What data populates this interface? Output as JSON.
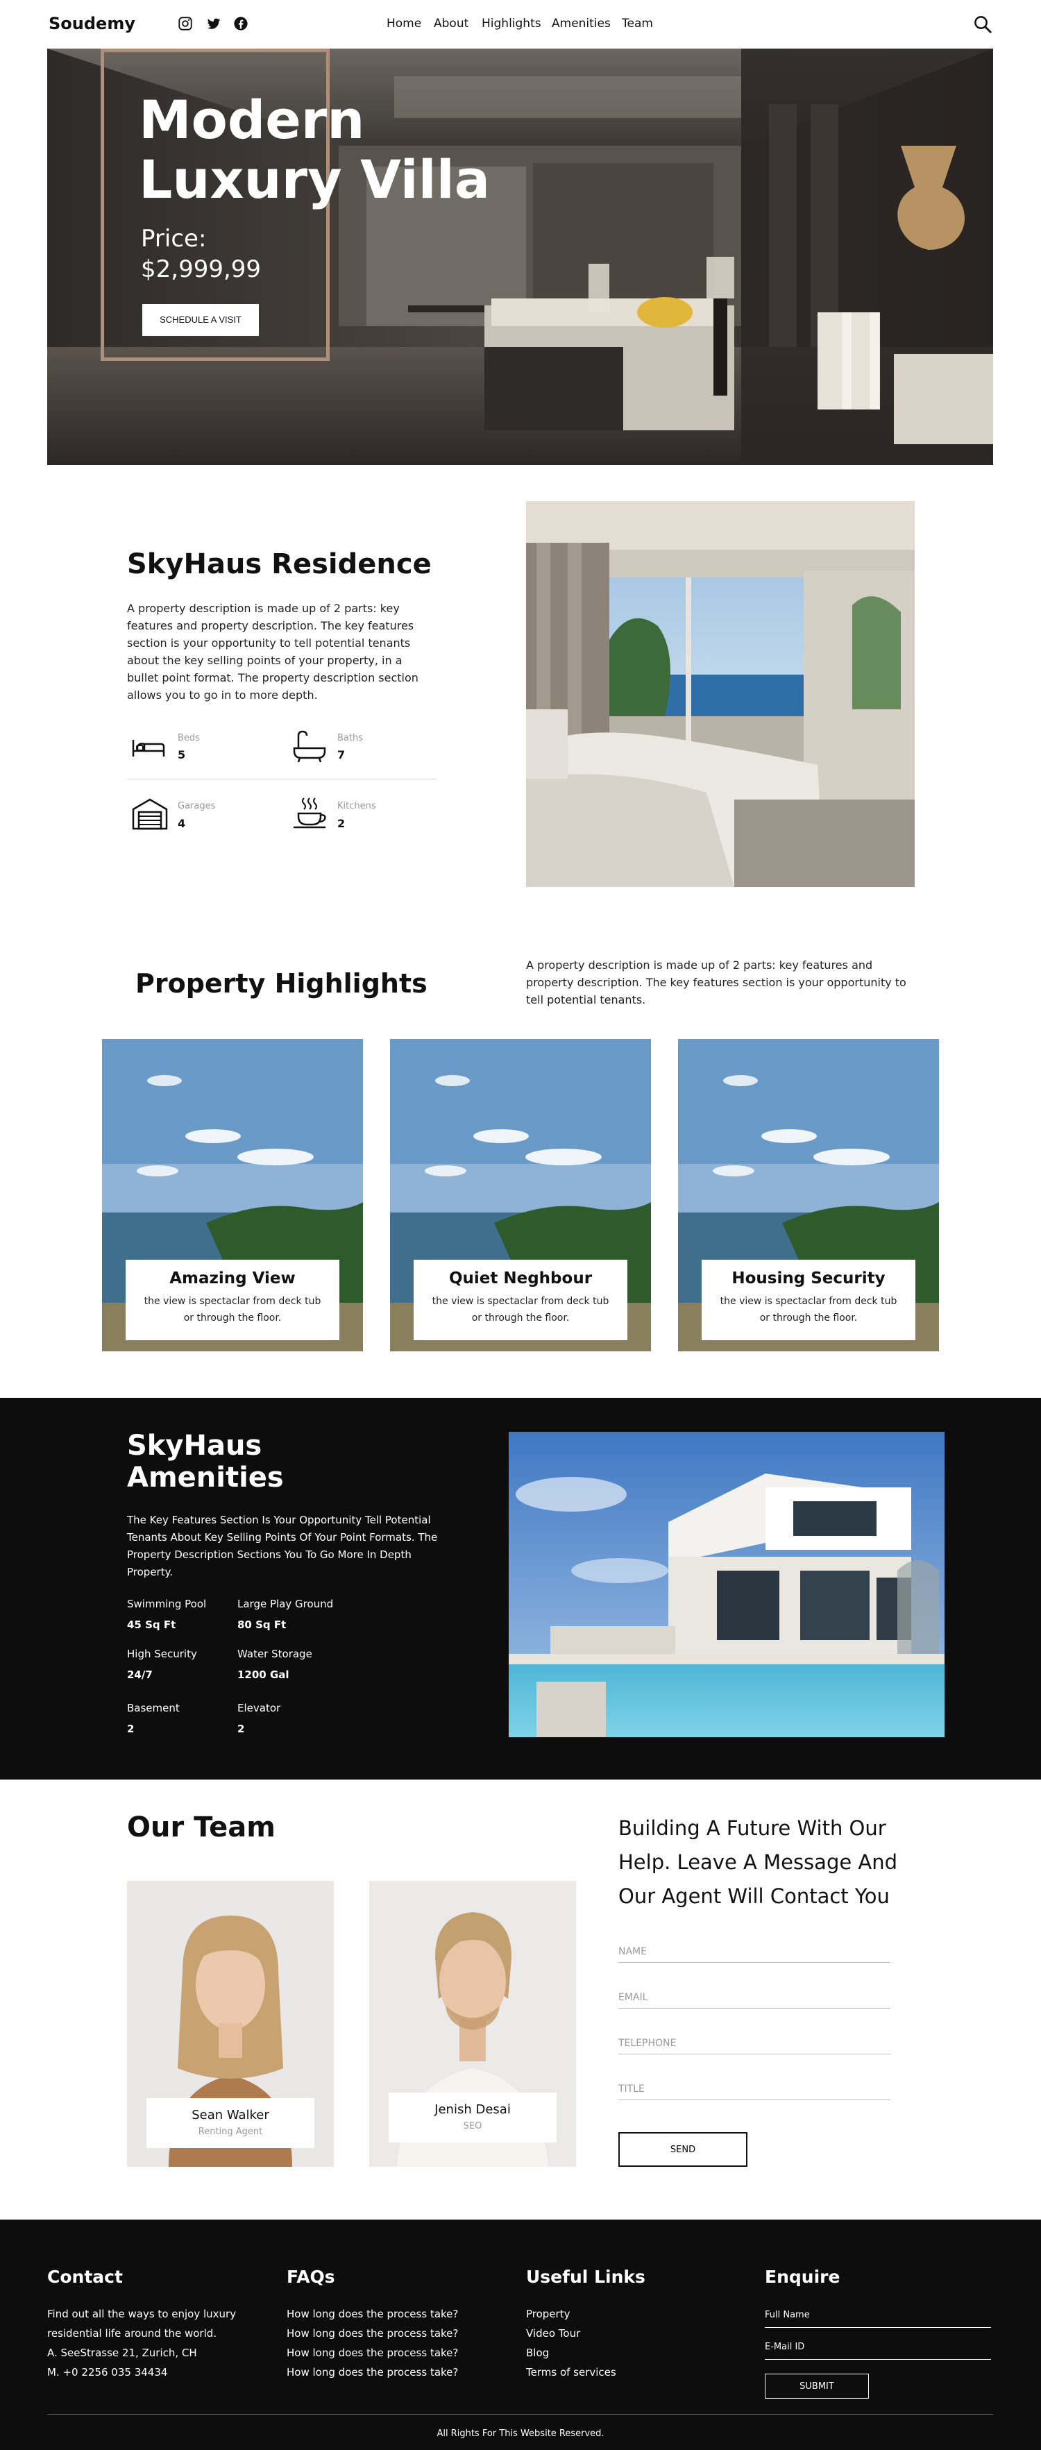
{
  "header": {
    "logo": "Soudemy",
    "nav": [
      "Home",
      "About",
      "Highlights",
      "Amenities",
      "Team"
    ],
    "social_icons": [
      "instagram-icon",
      "twitter-icon",
      "facebook-icon"
    ],
    "search_icon": "search-icon"
  },
  "hero": {
    "title": "Modern Luxury Villa",
    "price_label": "Price:",
    "price": "$2,999,99",
    "button": "SCHEDULE A VISIT"
  },
  "residence": {
    "title": "SkyHaus Residence",
    "description": "A property description is made up of 2 parts: key features and property description. The key features section is your opportunity to tell potential tenants about the key selling points of your property, in a bullet point format. The property description section allows you to go in to more depth.",
    "features": [
      {
        "icon": "bed-icon",
        "label": "Beds",
        "value": "5"
      },
      {
        "icon": "bathtub-icon",
        "label": "Baths",
        "value": "7"
      },
      {
        "icon": "garage-icon",
        "label": "Garages",
        "value": "4"
      },
      {
        "icon": "coffee-cup-icon",
        "label": "Kitchens",
        "value": "2"
      }
    ]
  },
  "highlights": {
    "title": "Property Highlights",
    "description": "A property description is made up of 2 parts: key features and property description. The key features section is your opportunity to tell potential tenants.",
    "cards": [
      {
        "title": "Amazing View",
        "desc": "the view is spectaclar from deck tub or through the floor."
      },
      {
        "title": "Quiet Neghbour",
        "desc": "the view is spectaclar from deck tub or through the floor."
      },
      {
        "title": "Housing Security",
        "desc": "the view is spectaclar from deck tub or through the floor."
      }
    ]
  },
  "amenities": {
    "title": "SkyHaus Amenities",
    "description": "The Key Features Section Is Your Opportunity Tell Potential Tenants About Key Selling Points Of Your Point Formats. The Property Description Sections You To Go More In Depth Property.",
    "items": [
      {
        "label": "Swimming Pool",
        "value": "45 Sq Ft"
      },
      {
        "label": "Large Play Ground",
        "value": "80 Sq Ft"
      },
      {
        "label": "High Security",
        "value": "24/7"
      },
      {
        "label": "Water Storage",
        "value": "1200 Gal"
      },
      {
        "label": "Basement",
        "value": "2"
      },
      {
        "label": "Elevator",
        "value": "2"
      }
    ]
  },
  "team": {
    "title": "Our Team",
    "members": [
      {
        "name": "Sean Walker",
        "role": "Renting Agent"
      },
      {
        "name": "Jenish Desai",
        "role": "SEO"
      }
    ]
  },
  "contact_form": {
    "title": "Building A Future With Our Help. Leave A Message And Our Agent Will Contact You",
    "fields": [
      "NAME",
      "EMAIL",
      "TELEPHONE",
      "TITLE"
    ],
    "button": "SEND"
  },
  "footer": {
    "contact": {
      "title": "Contact",
      "lines": [
        "Find out all the ways to enjoy luxury",
        "residential life around the world.",
        "A. SeeStrasse 21, Zurich, CH",
        "M. +0 2256 035 34434"
      ]
    },
    "faqs": {
      "title": "FAQs",
      "items": [
        "How long does the process take?",
        "How long does the process take?",
        "How long does the process take?",
        "How long does the process take?"
      ]
    },
    "links": {
      "title": "Useful Links",
      "items": [
        "Property",
        "Video Tour",
        "Blog",
        "Terms of services"
      ]
    },
    "enquire": {
      "title": "Enquire",
      "fields": [
        "Full Name",
        "E-Mail ID"
      ],
      "button": "SUBMIT"
    },
    "copyright": "All Rights For This Website Reserved."
  }
}
